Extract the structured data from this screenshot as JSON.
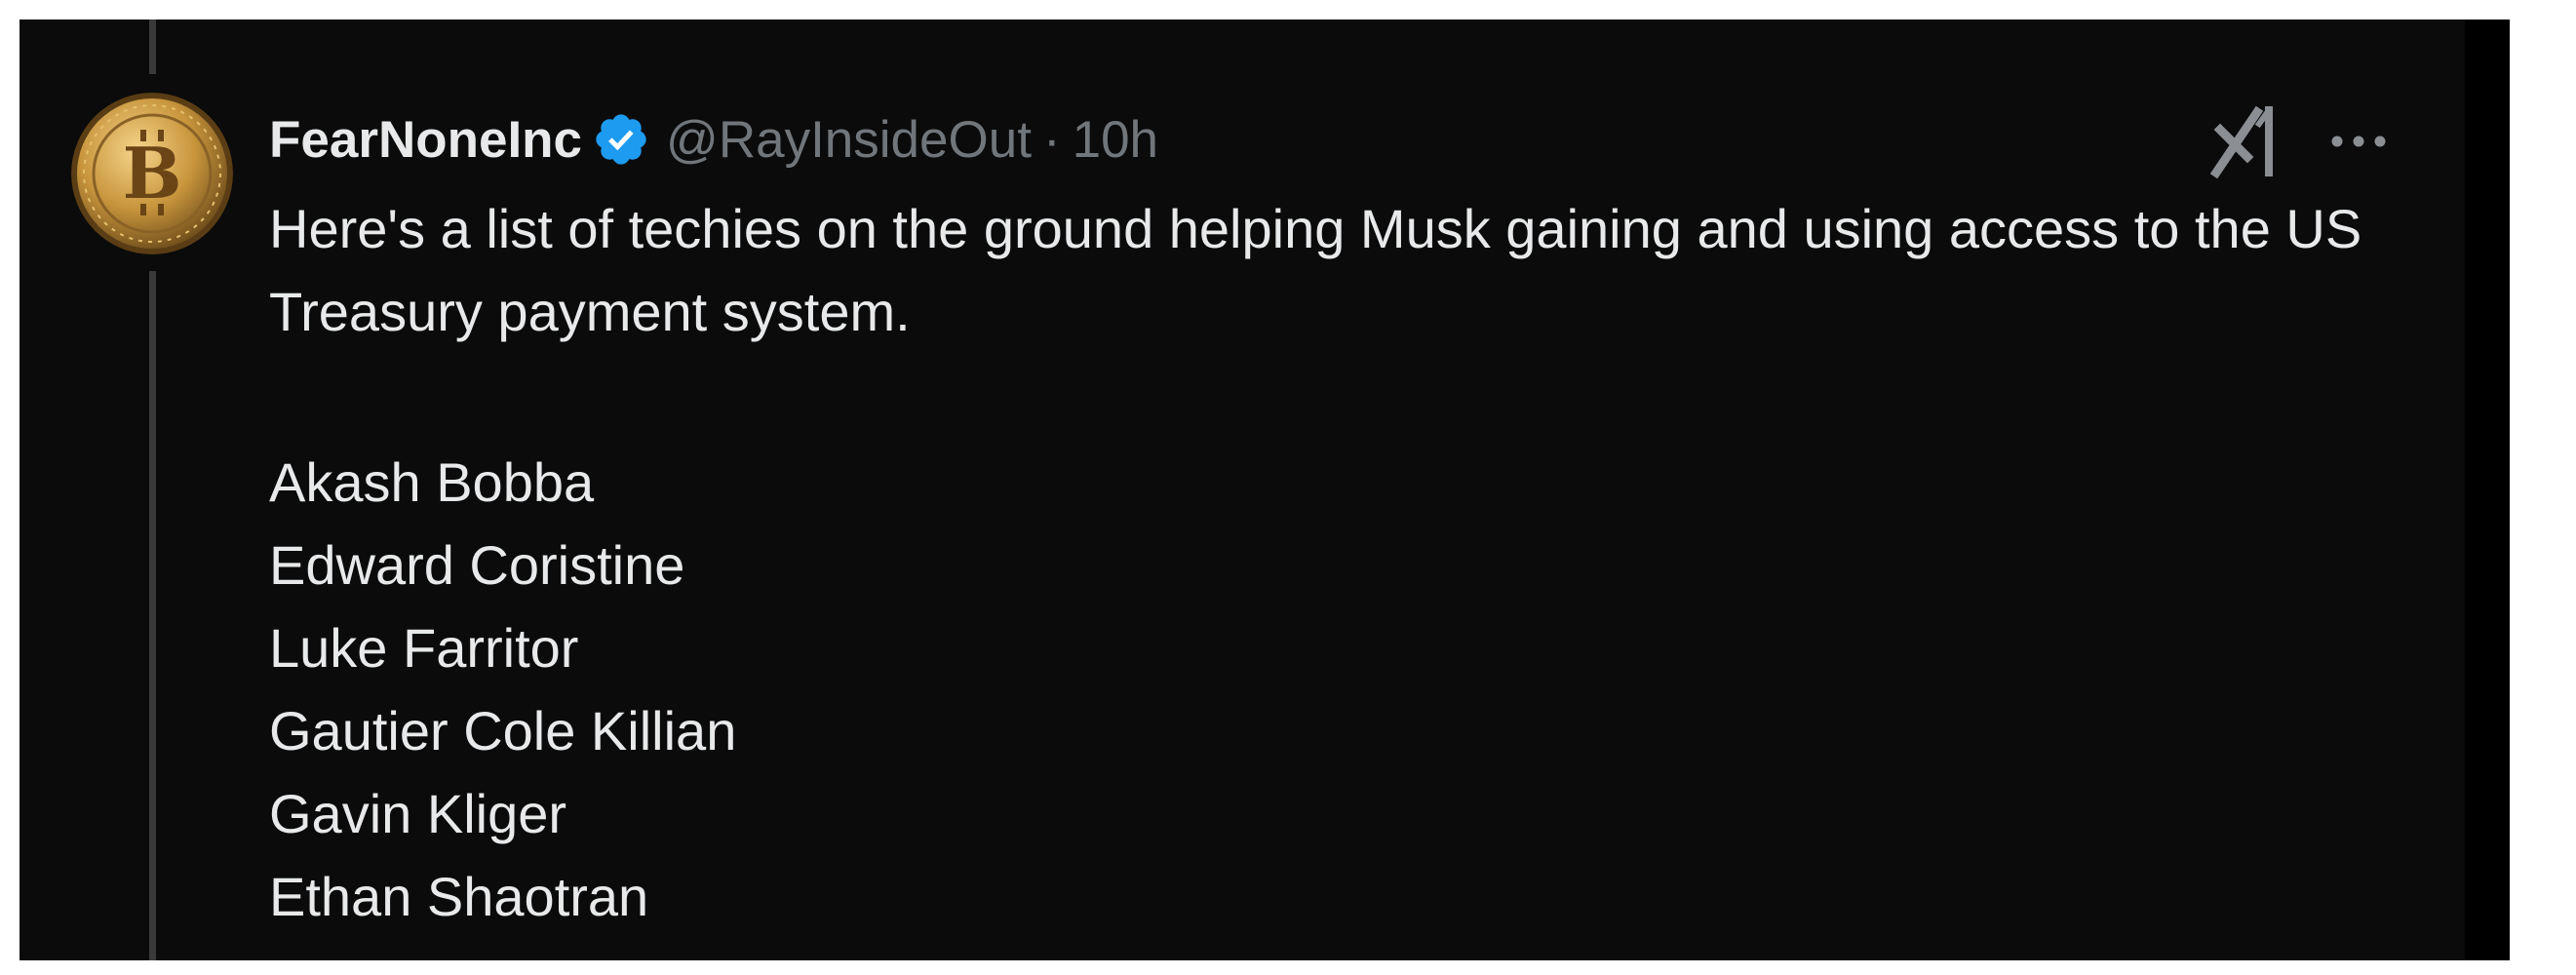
{
  "tweet": {
    "display_name": "FearNoneInc",
    "verified": true,
    "handle": "@RayInsideOut",
    "separator": "·",
    "time": "10h",
    "text": "Here's a list of techies on the ground helping Musk gaining and using access to the US Treasury payment system.",
    "names": [
      "Akash Bobba",
      "Edward Coristine",
      "Luke Farritor",
      "Gautier Cole Killian",
      "Gavin Kliger",
      "Ethan Shaotran"
    ]
  },
  "icons": {
    "avatar": "bitcoin-coin-avatar",
    "verified": "verified-badge-icon",
    "grok": "grok-icon",
    "more": "more-options-icon"
  },
  "colors": {
    "background": "#0b0b0b",
    "text_primary": "#e7e9ea",
    "text_secondary": "#71767b",
    "verified_blue": "#1d9bf0",
    "avatar_gold": "#c8953c"
  }
}
